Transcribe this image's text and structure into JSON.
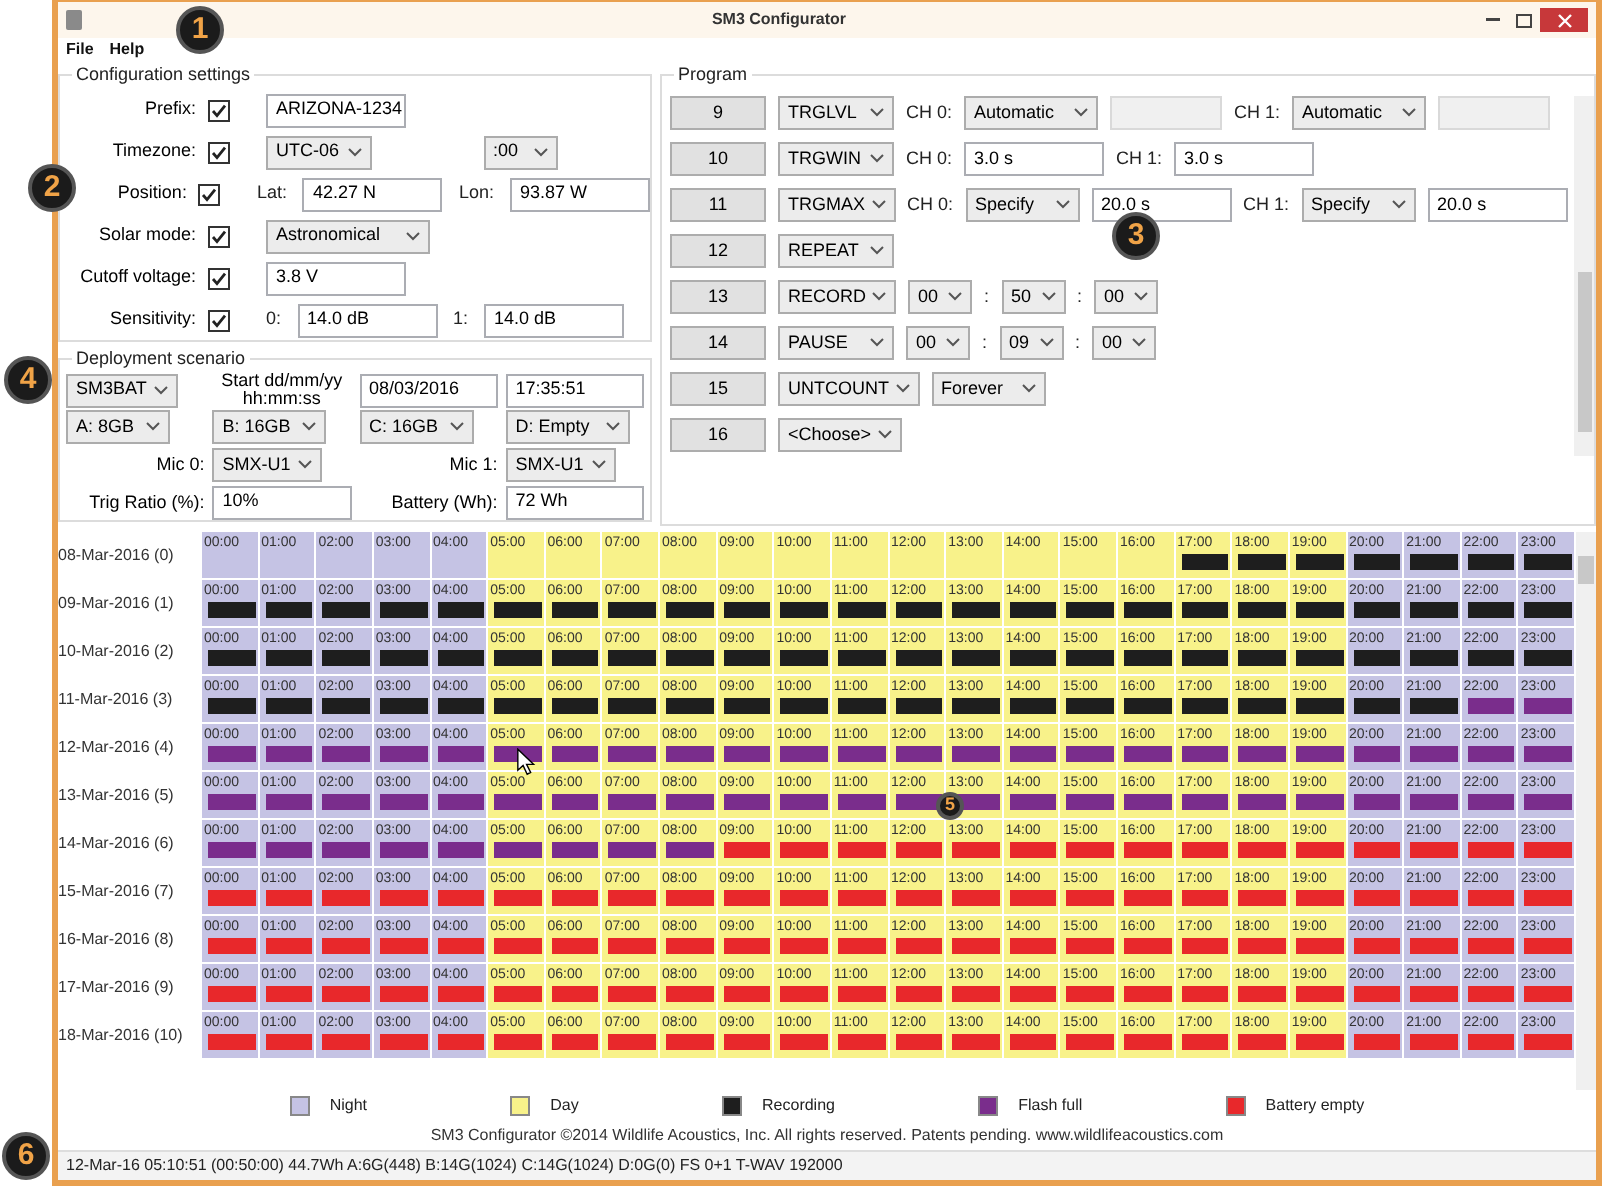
{
  "window": {
    "title": "SM3 Configurator"
  },
  "menu": [
    "File",
    "Help"
  ],
  "config": {
    "title": "Configuration settings",
    "rows": [
      {
        "label": "Prefix:",
        "checked": true,
        "params": [
          {
            "kind": "field",
            "value": "ARIZONA-1234"
          }
        ]
      },
      {
        "label": "Timezone:",
        "checked": true,
        "params": [
          {
            "kind": "select",
            "value": "UTC-06"
          },
          {
            "kind": "gap"
          },
          {
            "kind": "select",
            "value": ":00"
          }
        ]
      },
      {
        "label": "Position:",
        "checked": true,
        "params": [
          {
            "kind": "label",
            "text": "Lat:"
          },
          {
            "kind": "field",
            "value": "42.27 N"
          },
          {
            "kind": "label",
            "text": "Lon:"
          },
          {
            "kind": "field",
            "value": "93.87 W"
          }
        ]
      },
      {
        "label": "Solar mode:",
        "checked": true,
        "params": [
          {
            "kind": "select",
            "value": "Astronomical"
          }
        ]
      },
      {
        "label": "Cutoff voltage:",
        "checked": true,
        "params": [
          {
            "kind": "field",
            "value": "3.8 V"
          }
        ]
      },
      {
        "label": "Sensitivity:",
        "checked": true,
        "params": [
          {
            "kind": "label",
            "text": "0:"
          },
          {
            "kind": "field",
            "value": "14.0 dB"
          },
          {
            "kind": "label",
            "text": "1:"
          },
          {
            "kind": "field",
            "value": "14.0 dB"
          }
        ]
      }
    ]
  },
  "deployment": {
    "title": "Deployment scenario",
    "rows": [
      [
        {
          "kind": "select",
          "value": "SM3BAT"
        },
        {
          "kind": "label",
          "text": "Start dd/mm/yy hh:mm:ss"
        },
        {
          "kind": "field",
          "value": "08/03/2016"
        },
        {
          "kind": "field",
          "value": "17:35:51"
        }
      ],
      [
        {
          "kind": "select",
          "value": "A: 8GB"
        },
        {
          "kind": "select",
          "value": "B: 16GB"
        },
        {
          "kind": "select",
          "value": "C: 16GB"
        },
        {
          "kind": "select",
          "value": "D: Empty"
        }
      ],
      [
        {
          "kind": "label",
          "text": "Mic 0:"
        },
        {
          "kind": "select",
          "value": "SMX-U1"
        },
        {
          "kind": "label",
          "text": "Mic 1:"
        },
        {
          "kind": "select",
          "value": "SMX-U1"
        }
      ],
      [
        {
          "kind": "label",
          "text": "Trig Ratio (%):"
        },
        {
          "kind": "field",
          "value": "10%"
        },
        {
          "kind": "label",
          "text": "Battery (Wh):"
        },
        {
          "kind": "field",
          "value": "72 Wh"
        }
      ]
    ]
  },
  "program": {
    "title": "Program",
    "rows": [
      {
        "number": "9",
        "command": "TRGLVL",
        "params": [
          {
            "kind": "label",
            "text": "CH 0:"
          },
          {
            "kind": "select",
            "value": "Automatic"
          },
          {
            "kind": "disabled_field"
          },
          {
            "kind": "label",
            "text": "CH 1:"
          },
          {
            "kind": "select",
            "value": "Automatic"
          },
          {
            "kind": "disabled_field"
          }
        ]
      },
      {
        "number": "10",
        "command": "TRGWIN",
        "params": [
          {
            "kind": "label",
            "text": "CH 0:"
          },
          {
            "kind": "field",
            "value": "3.0 s"
          },
          {
            "kind": "label",
            "text": "CH 1:"
          },
          {
            "kind": "field",
            "value": "3.0 s"
          }
        ]
      },
      {
        "number": "11",
        "command": "TRGMAX",
        "params": [
          {
            "kind": "label",
            "text": "CH 0:"
          },
          {
            "kind": "select",
            "value": "Specify"
          },
          {
            "kind": "field",
            "value": "20.0 s"
          },
          {
            "kind": "label",
            "text": "CH 1:"
          },
          {
            "kind": "select",
            "value": "Specify"
          },
          {
            "kind": "field",
            "value": "20.0 s"
          }
        ]
      },
      {
        "number": "12",
        "command": "REPEAT",
        "params": []
      },
      {
        "number": "13",
        "command": "RECORD",
        "params": [
          {
            "kind": "select",
            "value": "00"
          },
          {
            "kind": "label",
            "text": ":"
          },
          {
            "kind": "select",
            "value": "50"
          },
          {
            "kind": "label",
            "text": ":"
          },
          {
            "kind": "select",
            "value": "00"
          }
        ]
      },
      {
        "number": "14",
        "command": "PAUSE",
        "params": [
          {
            "kind": "select",
            "value": "00"
          },
          {
            "kind": "label",
            "text": ":"
          },
          {
            "kind": "select",
            "value": "09"
          },
          {
            "kind": "label",
            "text": ":"
          },
          {
            "kind": "select",
            "value": "00"
          }
        ]
      },
      {
        "number": "15",
        "command": "UNTCOUNT",
        "params": [
          {
            "kind": "select",
            "value": "Forever"
          }
        ]
      },
      {
        "number": "16",
        "command": "<Choose>",
        "params": []
      }
    ]
  },
  "schedule": {
    "days": [
      {
        "label": "08-Mar-2016 (0)",
        "hours": [
          {
            "label": "00:00",
            "night": true,
            "kind": "idle"
          },
          {
            "label": "01:00",
            "night": true,
            "kind": "idle"
          },
          {
            "label": "02:00",
            "night": true,
            "kind": "idle"
          },
          {
            "label": "03:00",
            "night": true,
            "kind": "idle"
          },
          {
            "label": "04:00",
            "night": true,
            "kind": "idle"
          },
          {
            "label": "05:00",
            "night": false,
            "kind": "idle"
          },
          {
            "label": "06:00",
            "night": false,
            "kind": "idle"
          },
          {
            "label": "07:00",
            "night": false,
            "kind": "idle"
          },
          {
            "label": "08:00",
            "night": false,
            "kind": "idle"
          },
          {
            "label": "09:00",
            "night": false,
            "kind": "idle"
          },
          {
            "label": "10:00",
            "night": false,
            "kind": "idle"
          },
          {
            "label": "11:00",
            "night": false,
            "kind": "idle"
          },
          {
            "label": "12:00",
            "night": false,
            "kind": "idle"
          },
          {
            "label": "13:00",
            "night": false,
            "kind": "idle"
          },
          {
            "label": "14:00",
            "night": false,
            "kind": "idle"
          },
          {
            "label": "15:00",
            "night": false,
            "kind": "idle"
          },
          {
            "label": "16:00",
            "night": false,
            "kind": "idle"
          },
          {
            "label": "17:00",
            "night": false,
            "kind": "recording"
          },
          {
            "label": "18:00",
            "night": false,
            "kind": "recording"
          },
          {
            "label": "19:00",
            "night": false,
            "kind": "recording"
          },
          {
            "label": "20:00",
            "night": true,
            "kind": "recording"
          },
          {
            "label": "21:00",
            "night": true,
            "kind": "recording"
          },
          {
            "label": "22:00",
            "night": true,
            "kind": "recording"
          },
          {
            "label": "23:00",
            "night": true,
            "kind": "recording"
          }
        ]
      },
      {
        "label": "09-Mar-2016 (1)",
        "hours": [
          {
            "label": "00:00",
            "night": true,
            "kind": "recording"
          },
          {
            "label": "01:00",
            "night": true,
            "kind": "recording"
          },
          {
            "label": "02:00",
            "night": true,
            "kind": "recording"
          },
          {
            "label": "03:00",
            "night": true,
            "kind": "recording"
          },
          {
            "label": "04:00",
            "night": true,
            "kind": "recording"
          },
          {
            "label": "05:00",
            "night": false,
            "kind": "recording"
          },
          {
            "label": "06:00",
            "night": false,
            "kind": "recording"
          },
          {
            "label": "07:00",
            "night": false,
            "kind": "recording"
          },
          {
            "label": "08:00",
            "night": false,
            "kind": "recording"
          },
          {
            "label": "09:00",
            "night": false,
            "kind": "recording"
          },
          {
            "label": "10:00",
            "night": false,
            "kind": "recording"
          },
          {
            "label": "11:00",
            "night": false,
            "kind": "recording"
          },
          {
            "label": "12:00",
            "night": false,
            "kind": "recording"
          },
          {
            "label": "13:00",
            "night": false,
            "kind": "recording"
          },
          {
            "label": "14:00",
            "night": false,
            "kind": "recording"
          },
          {
            "label": "15:00",
            "night": false,
            "kind": "recording"
          },
          {
            "label": "16:00",
            "night": false,
            "kind": "recording"
          },
          {
            "label": "17:00",
            "night": false,
            "kind": "recording"
          },
          {
            "label": "18:00",
            "night": false,
            "kind": "recording"
          },
          {
            "label": "19:00",
            "night": false,
            "kind": "recording"
          },
          {
            "label": "20:00",
            "night": true,
            "kind": "recording"
          },
          {
            "label": "21:00",
            "night": true,
            "kind": "recording"
          },
          {
            "label": "22:00",
            "night": true,
            "kind": "recording"
          },
          {
            "label": "23:00",
            "night": true,
            "kind": "recording"
          }
        ]
      },
      {
        "label": "10-Mar-2016 (2)",
        "hours": [
          {
            "label": "00:00",
            "night": true,
            "kind": "recording"
          },
          {
            "label": "01:00",
            "night": true,
            "kind": "recording"
          },
          {
            "label": "02:00",
            "night": true,
            "kind": "recording"
          },
          {
            "label": "03:00",
            "night": true,
            "kind": "recording"
          },
          {
            "label": "04:00",
            "night": true,
            "kind": "recording"
          },
          {
            "label": "05:00",
            "night": false,
            "kind": "recording"
          },
          {
            "label": "06:00",
            "night": false,
            "kind": "recording"
          },
          {
            "label": "07:00",
            "night": false,
            "kind": "recording"
          },
          {
            "label": "08:00",
            "night": false,
            "kind": "recording"
          },
          {
            "label": "09:00",
            "night": false,
            "kind": "recording"
          },
          {
            "label": "10:00",
            "night": false,
            "kind": "recording"
          },
          {
            "label": "11:00",
            "night": false,
            "kind": "recording"
          },
          {
            "label": "12:00",
            "night": false,
            "kind": "recording"
          },
          {
            "label": "13:00",
            "night": false,
            "kind": "recording"
          },
          {
            "label": "14:00",
            "night": false,
            "kind": "recording"
          },
          {
            "label": "15:00",
            "night": false,
            "kind": "recording"
          },
          {
            "label": "16:00",
            "night": false,
            "kind": "recording"
          },
          {
            "label": "17:00",
            "night": false,
            "kind": "recording"
          },
          {
            "label": "18:00",
            "night": false,
            "kind": "recording"
          },
          {
            "label": "19:00",
            "night": false,
            "kind": "recording"
          },
          {
            "label": "20:00",
            "night": true,
            "kind": "recording"
          },
          {
            "label": "21:00",
            "night": true,
            "kind": "recording"
          },
          {
            "label": "22:00",
            "night": true,
            "kind": "recording"
          },
          {
            "label": "23:00",
            "night": true,
            "kind": "recording"
          }
        ]
      },
      {
        "label": "11-Mar-2016 (3)",
        "hours": [
          {
            "label": "00:00",
            "night": true,
            "kind": "recording"
          },
          {
            "label": "01:00",
            "night": true,
            "kind": "recording"
          },
          {
            "label": "02:00",
            "night": true,
            "kind": "recording"
          },
          {
            "label": "03:00",
            "night": true,
            "kind": "recording"
          },
          {
            "label": "04:00",
            "night": true,
            "kind": "recording"
          },
          {
            "label": "05:00",
            "night": false,
            "kind": "recording"
          },
          {
            "label": "06:00",
            "night": false,
            "kind": "recording"
          },
          {
            "label": "07:00",
            "night": false,
            "kind": "recording"
          },
          {
            "label": "08:00",
            "night": false,
            "kind": "recording"
          },
          {
            "label": "09:00",
            "night": false,
            "kind": "recording"
          },
          {
            "label": "10:00",
            "night": false,
            "kind": "recording"
          },
          {
            "label": "11:00",
            "night": false,
            "kind": "recording"
          },
          {
            "label": "12:00",
            "night": false,
            "kind": "recording"
          },
          {
            "label": "13:00",
            "night": false,
            "kind": "recording"
          },
          {
            "label": "14:00",
            "night": false,
            "kind": "recording"
          },
          {
            "label": "15:00",
            "night": false,
            "kind": "recording"
          },
          {
            "label": "16:00",
            "night": false,
            "kind": "recording"
          },
          {
            "label": "17:00",
            "night": false,
            "kind": "recording"
          },
          {
            "label": "18:00",
            "night": false,
            "kind": "recording"
          },
          {
            "label": "19:00",
            "night": false,
            "kind": "recording"
          },
          {
            "label": "20:00",
            "night": true,
            "kind": "recording"
          },
          {
            "label": "21:00",
            "night": true,
            "kind": "recording"
          },
          {
            "label": "22:00",
            "night": true,
            "kind": "flash_full"
          },
          {
            "label": "23:00",
            "night": true,
            "kind": "flash_full"
          }
        ]
      },
      {
        "label": "12-Mar-2016 (4)",
        "hours": [
          {
            "label": "00:00",
            "night": true,
            "kind": "flash_full"
          },
          {
            "label": "01:00",
            "night": true,
            "kind": "flash_full"
          },
          {
            "label": "02:00",
            "night": true,
            "kind": "flash_full"
          },
          {
            "label": "03:00",
            "night": true,
            "kind": "flash_full"
          },
          {
            "label": "04:00",
            "night": true,
            "kind": "flash_full"
          },
          {
            "label": "05:00",
            "night": false,
            "kind": "flash_full"
          },
          {
            "label": "06:00",
            "night": false,
            "kind": "flash_full"
          },
          {
            "label": "07:00",
            "night": false,
            "kind": "flash_full"
          },
          {
            "label": "08:00",
            "night": false,
            "kind": "flash_full"
          },
          {
            "label": "09:00",
            "night": false,
            "kind": "flash_full"
          },
          {
            "label": "10:00",
            "night": false,
            "kind": "flash_full"
          },
          {
            "label": "11:00",
            "night": false,
            "kind": "flash_full"
          },
          {
            "label": "12:00",
            "night": false,
            "kind": "flash_full"
          },
          {
            "label": "13:00",
            "night": false,
            "kind": "flash_full"
          },
          {
            "label": "14:00",
            "night": false,
            "kind": "flash_full"
          },
          {
            "label": "15:00",
            "night": false,
            "kind": "flash_full"
          },
          {
            "label": "16:00",
            "night": false,
            "kind": "flash_full"
          },
          {
            "label": "17:00",
            "night": false,
            "kind": "flash_full"
          },
          {
            "label": "18:00",
            "night": false,
            "kind": "flash_full"
          },
          {
            "label": "19:00",
            "night": false,
            "kind": "flash_full"
          },
          {
            "label": "20:00",
            "night": true,
            "kind": "flash_full"
          },
          {
            "label": "21:00",
            "night": true,
            "kind": "flash_full"
          },
          {
            "label": "22:00",
            "night": true,
            "kind": "flash_full"
          },
          {
            "label": "23:00",
            "night": true,
            "kind": "flash_full"
          }
        ]
      },
      {
        "label": "13-Mar-2016 (5)",
        "hours": [
          {
            "label": "00:00",
            "night": true,
            "kind": "flash_full"
          },
          {
            "label": "01:00",
            "night": true,
            "kind": "flash_full"
          },
          {
            "label": "02:00",
            "night": true,
            "kind": "flash_full"
          },
          {
            "label": "03:00",
            "night": true,
            "kind": "flash_full"
          },
          {
            "label": "04:00",
            "night": true,
            "kind": "flash_full"
          },
          {
            "label": "05:00",
            "night": false,
            "kind": "flash_full"
          },
          {
            "label": "06:00",
            "night": false,
            "kind": "flash_full"
          },
          {
            "label": "07:00",
            "night": false,
            "kind": "flash_full"
          },
          {
            "label": "08:00",
            "night": false,
            "kind": "flash_full"
          },
          {
            "label": "09:00",
            "night": false,
            "kind": "flash_full"
          },
          {
            "label": "10:00",
            "night": false,
            "kind": "flash_full"
          },
          {
            "label": "11:00",
            "night": false,
            "kind": "flash_full"
          },
          {
            "label": "12:00",
            "night": false,
            "kind": "flash_full"
          },
          {
            "label": "13:00",
            "night": false,
            "kind": "flash_full"
          },
          {
            "label": "14:00",
            "night": false,
            "kind": "flash_full"
          },
          {
            "label": "15:00",
            "night": false,
            "kind": "flash_full"
          },
          {
            "label": "16:00",
            "night": false,
            "kind": "flash_full"
          },
          {
            "label": "17:00",
            "night": false,
            "kind": "flash_full"
          },
          {
            "label": "18:00",
            "night": false,
            "kind": "flash_full"
          },
          {
            "label": "19:00",
            "night": false,
            "kind": "flash_full"
          },
          {
            "label": "20:00",
            "night": true,
            "kind": "flash_full"
          },
          {
            "label": "21:00",
            "night": true,
            "kind": "flash_full"
          },
          {
            "label": "22:00",
            "night": true,
            "kind": "flash_full"
          },
          {
            "label": "23:00",
            "night": true,
            "kind": "flash_full"
          }
        ]
      },
      {
        "label": "14-Mar-2016 (6)",
        "hours": [
          {
            "label": "00:00",
            "night": true,
            "kind": "flash_full"
          },
          {
            "label": "01:00",
            "night": true,
            "kind": "flash_full"
          },
          {
            "label": "02:00",
            "night": true,
            "kind": "flash_full"
          },
          {
            "label": "03:00",
            "night": true,
            "kind": "flash_full"
          },
          {
            "label": "04:00",
            "night": true,
            "kind": "flash_full"
          },
          {
            "label": "05:00",
            "night": false,
            "kind": "flash_full"
          },
          {
            "label": "06:00",
            "night": false,
            "kind": "flash_full"
          },
          {
            "label": "07:00",
            "night": false,
            "kind": "flash_full"
          },
          {
            "label": "08:00",
            "night": false,
            "kind": "flash_full"
          },
          {
            "label": "09:00",
            "night": false,
            "kind": "battery_empty"
          },
          {
            "label": "10:00",
            "night": false,
            "kind": "battery_empty"
          },
          {
            "label": "11:00",
            "night": false,
            "kind": "battery_empty"
          },
          {
            "label": "12:00",
            "night": false,
            "kind": "battery_empty"
          },
          {
            "label": "13:00",
            "night": false,
            "kind": "battery_empty"
          },
          {
            "label": "14:00",
            "night": false,
            "kind": "battery_empty"
          },
          {
            "label": "15:00",
            "night": false,
            "kind": "battery_empty"
          },
          {
            "label": "16:00",
            "night": false,
            "kind": "battery_empty"
          },
          {
            "label": "17:00",
            "night": false,
            "kind": "battery_empty"
          },
          {
            "label": "18:00",
            "night": false,
            "kind": "battery_empty"
          },
          {
            "label": "19:00",
            "night": false,
            "kind": "battery_empty"
          },
          {
            "label": "20:00",
            "night": true,
            "kind": "battery_empty"
          },
          {
            "label": "21:00",
            "night": true,
            "kind": "battery_empty"
          },
          {
            "label": "22:00",
            "night": true,
            "kind": "battery_empty"
          },
          {
            "label": "23:00",
            "night": true,
            "kind": "battery_empty"
          }
        ]
      },
      {
        "label": "15-Mar-2016 (7)",
        "hours": [
          {
            "label": "00:00",
            "night": true,
            "kind": "battery_empty"
          },
          {
            "label": "01:00",
            "night": true,
            "kind": "battery_empty"
          },
          {
            "label": "02:00",
            "night": true,
            "kind": "battery_empty"
          },
          {
            "label": "03:00",
            "night": true,
            "kind": "battery_empty"
          },
          {
            "label": "04:00",
            "night": true,
            "kind": "battery_empty"
          },
          {
            "label": "05:00",
            "night": false,
            "kind": "battery_empty"
          },
          {
            "label": "06:00",
            "night": false,
            "kind": "battery_empty"
          },
          {
            "label": "07:00",
            "night": false,
            "kind": "battery_empty"
          },
          {
            "label": "08:00",
            "night": false,
            "kind": "battery_empty"
          },
          {
            "label": "09:00",
            "night": false,
            "kind": "battery_empty"
          },
          {
            "label": "10:00",
            "night": false,
            "kind": "battery_empty"
          },
          {
            "label": "11:00",
            "night": false,
            "kind": "battery_empty"
          },
          {
            "label": "12:00",
            "night": false,
            "kind": "battery_empty"
          },
          {
            "label": "13:00",
            "night": false,
            "kind": "battery_empty"
          },
          {
            "label": "14:00",
            "night": false,
            "kind": "battery_empty"
          },
          {
            "label": "15:00",
            "night": false,
            "kind": "battery_empty"
          },
          {
            "label": "16:00",
            "night": false,
            "kind": "battery_empty"
          },
          {
            "label": "17:00",
            "night": false,
            "kind": "battery_empty"
          },
          {
            "label": "18:00",
            "night": false,
            "kind": "battery_empty"
          },
          {
            "label": "19:00",
            "night": false,
            "kind": "battery_empty"
          },
          {
            "label": "20:00",
            "night": true,
            "kind": "battery_empty"
          },
          {
            "label": "21:00",
            "night": true,
            "kind": "battery_empty"
          },
          {
            "label": "22:00",
            "night": true,
            "kind": "battery_empty"
          },
          {
            "label": "23:00",
            "night": true,
            "kind": "battery_empty"
          }
        ]
      },
      {
        "label": "16-Mar-2016 (8)",
        "hours": [
          {
            "label": "00:00",
            "night": true,
            "kind": "battery_empty"
          },
          {
            "label": "01:00",
            "night": true,
            "kind": "battery_empty"
          },
          {
            "label": "02:00",
            "night": true,
            "kind": "battery_empty"
          },
          {
            "label": "03:00",
            "night": true,
            "kind": "battery_empty"
          },
          {
            "label": "04:00",
            "night": true,
            "kind": "battery_empty"
          },
          {
            "label": "05:00",
            "night": false,
            "kind": "battery_empty"
          },
          {
            "label": "06:00",
            "night": false,
            "kind": "battery_empty"
          },
          {
            "label": "07:00",
            "night": false,
            "kind": "battery_empty"
          },
          {
            "label": "08:00",
            "night": false,
            "kind": "battery_empty"
          },
          {
            "label": "09:00",
            "night": false,
            "kind": "battery_empty"
          },
          {
            "label": "10:00",
            "night": false,
            "kind": "battery_empty"
          },
          {
            "label": "11:00",
            "night": false,
            "kind": "battery_empty"
          },
          {
            "label": "12:00",
            "night": false,
            "kind": "battery_empty"
          },
          {
            "label": "13:00",
            "night": false,
            "kind": "battery_empty"
          },
          {
            "label": "14:00",
            "night": false,
            "kind": "battery_empty"
          },
          {
            "label": "15:00",
            "night": false,
            "kind": "battery_empty"
          },
          {
            "label": "16:00",
            "night": false,
            "kind": "battery_empty"
          },
          {
            "label": "17:00",
            "night": false,
            "kind": "battery_empty"
          },
          {
            "label": "18:00",
            "night": false,
            "kind": "battery_empty"
          },
          {
            "label": "19:00",
            "night": false,
            "kind": "battery_empty"
          },
          {
            "label": "20:00",
            "night": true,
            "kind": "battery_empty"
          },
          {
            "label": "21:00",
            "night": true,
            "kind": "battery_empty"
          },
          {
            "label": "22:00",
            "night": true,
            "kind": "battery_empty"
          },
          {
            "label": "23:00",
            "night": true,
            "kind": "battery_empty"
          }
        ]
      },
      {
        "label": "17-Mar-2016 (9)",
        "hours": [
          {
            "label": "00:00",
            "night": true,
            "kind": "battery_empty"
          },
          {
            "label": "01:00",
            "night": true,
            "kind": "battery_empty"
          },
          {
            "label": "02:00",
            "night": true,
            "kind": "battery_empty"
          },
          {
            "label": "03:00",
            "night": true,
            "kind": "battery_empty"
          },
          {
            "label": "04:00",
            "night": true,
            "kind": "battery_empty"
          },
          {
            "label": "05:00",
            "night": false,
            "kind": "battery_empty"
          },
          {
            "label": "06:00",
            "night": false,
            "kind": "battery_empty"
          },
          {
            "label": "07:00",
            "night": false,
            "kind": "battery_empty"
          },
          {
            "label": "08:00",
            "night": false,
            "kind": "battery_empty"
          },
          {
            "label": "09:00",
            "night": false,
            "kind": "battery_empty"
          },
          {
            "label": "10:00",
            "night": false,
            "kind": "battery_empty"
          },
          {
            "label": "11:00",
            "night": false,
            "kind": "battery_empty"
          },
          {
            "label": "12:00",
            "night": false,
            "kind": "battery_empty"
          },
          {
            "label": "13:00",
            "night": false,
            "kind": "battery_empty"
          },
          {
            "label": "14:00",
            "night": false,
            "kind": "battery_empty"
          },
          {
            "label": "15:00",
            "night": false,
            "kind": "battery_empty"
          },
          {
            "label": "16:00",
            "night": false,
            "kind": "battery_empty"
          },
          {
            "label": "17:00",
            "night": false,
            "kind": "battery_empty"
          },
          {
            "label": "18:00",
            "night": false,
            "kind": "battery_empty"
          },
          {
            "label": "19:00",
            "night": false,
            "kind": "battery_empty"
          },
          {
            "label": "20:00",
            "night": true,
            "kind": "battery_empty"
          },
          {
            "label": "21:00",
            "night": true,
            "kind": "battery_empty"
          },
          {
            "label": "22:00",
            "night": true,
            "kind": "battery_empty"
          },
          {
            "label": "23:00",
            "night": true,
            "kind": "battery_empty"
          }
        ]
      },
      {
        "label": "18-Mar-2016 (10)",
        "hours": [
          {
            "label": "00:00",
            "night": true,
            "kind": "battery_empty"
          },
          {
            "label": "01:00",
            "night": true,
            "kind": "battery_empty"
          },
          {
            "label": "02:00",
            "night": true,
            "kind": "battery_empty"
          },
          {
            "label": "03:00",
            "night": true,
            "kind": "battery_empty"
          },
          {
            "label": "04:00",
            "night": true,
            "kind": "battery_empty"
          },
          {
            "label": "05:00",
            "night": false,
            "kind": "battery_empty"
          },
          {
            "label": "06:00",
            "night": false,
            "kind": "battery_empty"
          },
          {
            "label": "07:00",
            "night": false,
            "kind": "battery_empty"
          },
          {
            "label": "08:00",
            "night": false,
            "kind": "battery_empty"
          },
          {
            "label": "09:00",
            "night": false,
            "kind": "battery_empty"
          },
          {
            "label": "10:00",
            "night": false,
            "kind": "battery_empty"
          },
          {
            "label": "11:00",
            "night": false,
            "kind": "battery_empty"
          },
          {
            "label": "12:00",
            "night": false,
            "kind": "battery_empty"
          },
          {
            "label": "13:00",
            "night": false,
            "kind": "battery_empty"
          },
          {
            "label": "14:00",
            "night": false,
            "kind": "battery_empty"
          },
          {
            "label": "15:00",
            "night": false,
            "kind": "battery_empty"
          },
          {
            "label": "16:00",
            "night": false,
            "kind": "battery_empty"
          },
          {
            "label": "17:00",
            "night": false,
            "kind": "battery_empty"
          },
          {
            "label": "18:00",
            "night": false,
            "kind": "battery_empty"
          },
          {
            "label": "19:00",
            "night": false,
            "kind": "battery_empty"
          },
          {
            "label": "20:00",
            "night": true,
            "kind": "battery_empty"
          },
          {
            "label": "21:00",
            "night": true,
            "kind": "battery_empty"
          },
          {
            "label": "22:00",
            "night": true,
            "kind": "battery_empty"
          },
          {
            "label": "23:00",
            "night": true,
            "kind": "battery_empty"
          }
        ]
      }
    ]
  },
  "legend": [
    {
      "label": "Night",
      "color": "#c5c3e4"
    },
    {
      "label": "Day",
      "color": "#f8f28a"
    },
    {
      "label": "Recording",
      "color": "#1e1e1e"
    },
    {
      "label": "Flash full",
      "color": "#7a2d8c"
    },
    {
      "label": "Battery empty",
      "color": "#e8282b"
    }
  ],
  "footer": "SM3 Configurator ©2014 Wildlife Acoustics, Inc. All rights reserved. Patents pending. www.wildlifeacoustics.com",
  "status_bar": "12-Mar-16 05:10:51 (00:50:00) 44.7Wh A:6G(448) B:14G(1024) C:14G(1024) D:0G(0) FS 0+1 T-WAV 192000",
  "callouts": [
    "1",
    "2",
    "3",
    "4",
    "5",
    "6"
  ]
}
